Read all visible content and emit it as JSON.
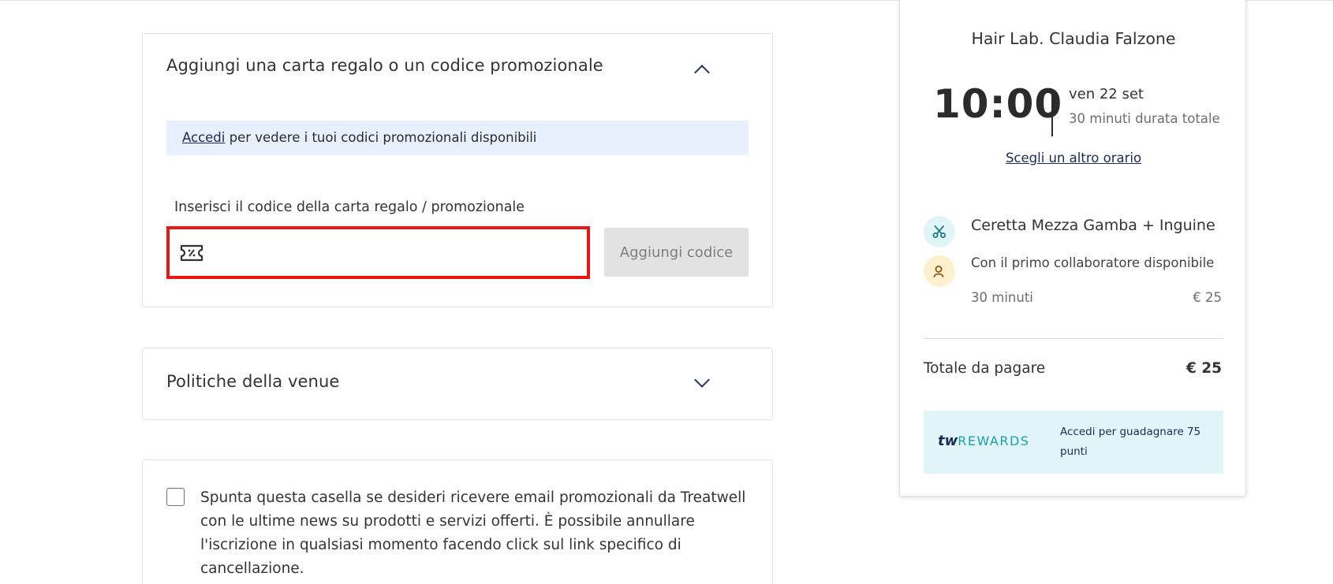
{
  "promo": {
    "title": "Aggiungi una carta regalo o un codice promozionale",
    "info_link": "Accedi",
    "info_text": " per vedere i tuoi codici promozionali disponibili",
    "field_label": "Inserisci il codice della carta regalo / promozionale",
    "input_value": "",
    "input_placeholder": "",
    "add_button": "Aggiungi codice"
  },
  "policy": {
    "title": "Politiche della venue"
  },
  "consent": {
    "checked": false,
    "text": "Spunta questa casella se desideri ricevere email promozionali da Treatwell con le ultime news su prodotti e servizi offerti. È possibile annullare l'iscrizione in qualsiasi momento facendo click sul link specifico di cancellazione."
  },
  "summary": {
    "venue": "Hair Lab. Claudia Falzone",
    "time": "10:00",
    "date": "ven 22 set",
    "total_duration": "30 minuti durata totale",
    "change_time_link": "Scegli un altro orario",
    "service_name": "Ceretta Mezza Gamba + Inguine",
    "staff": "Con il primo collaboratore disponibile",
    "service_duration": "30 minuti",
    "service_price": "€ 25",
    "total_label": "Totale da pagare",
    "total_value": "€ 25",
    "rewards_logo_tw": "tw",
    "rewards_logo_word": "REWARDS",
    "rewards_text": "Accedi per guadagnare 75 punti"
  },
  "colors": {
    "highlight_border": "#ea1515",
    "info_bg": "#e8effd",
    "navy": "#1c2a55",
    "teal": "#1aa0a8"
  },
  "icons": {
    "ticket": "ticket-percent-icon",
    "chevron_up": "chevron-up-icon",
    "chevron_down": "chevron-down-icon",
    "scissors": "scissors-icon",
    "person": "person-icon"
  }
}
